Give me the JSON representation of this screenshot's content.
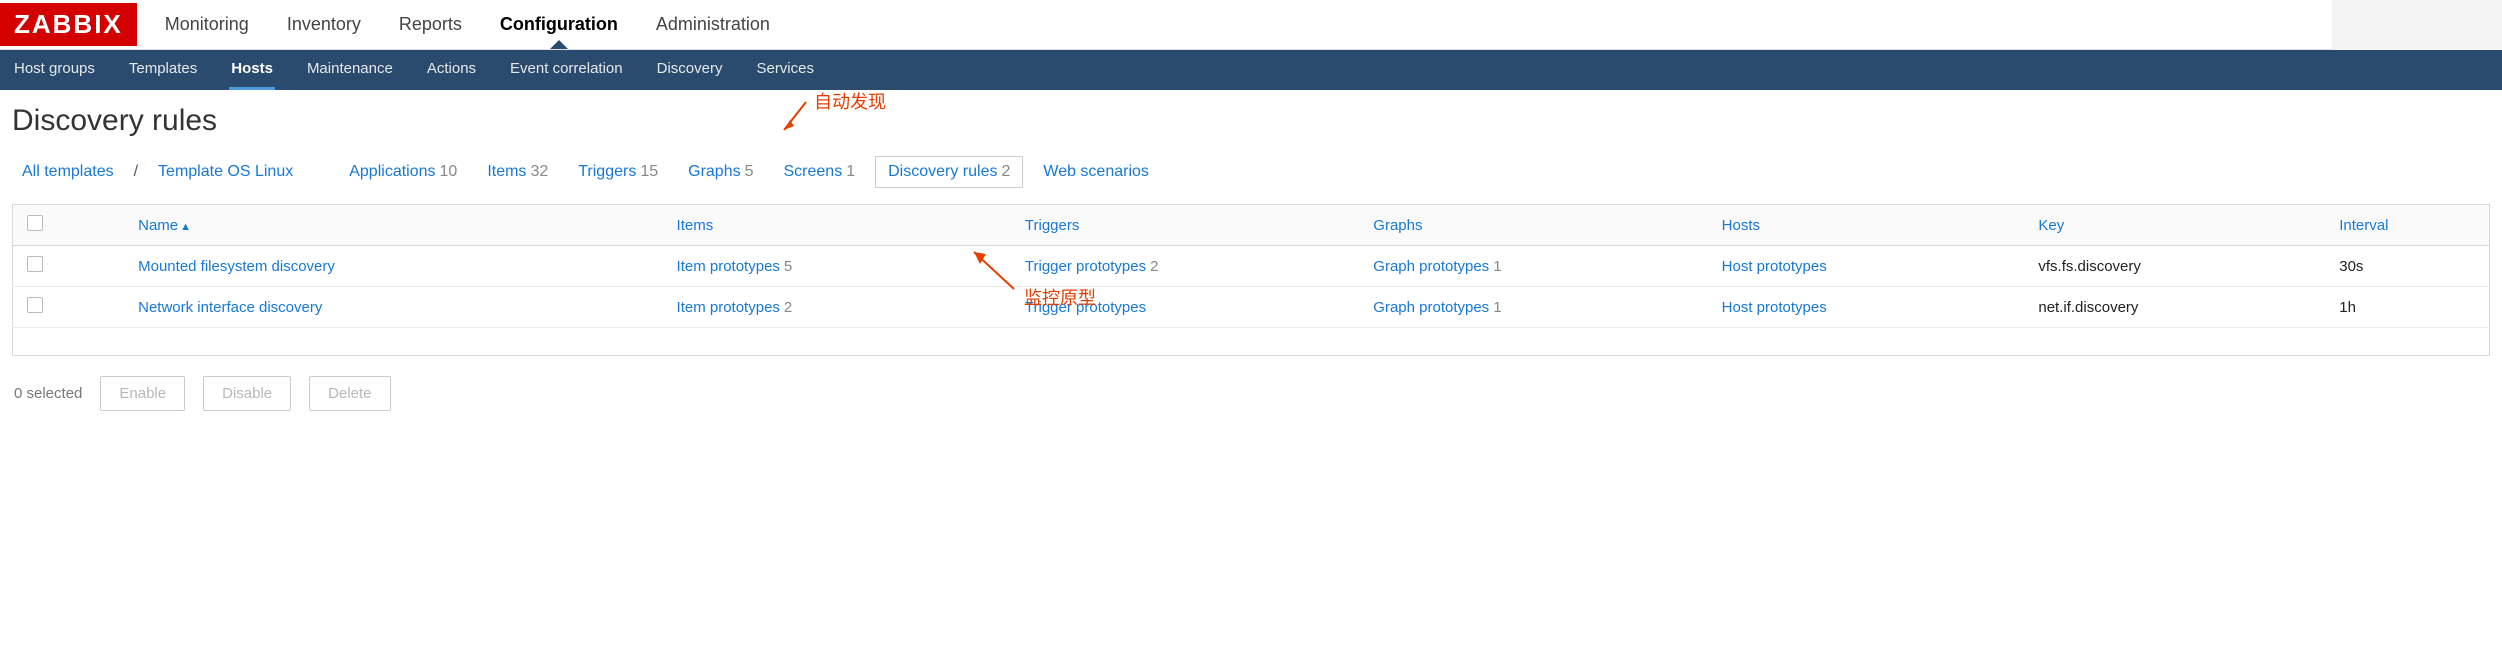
{
  "logo": "ZABBIX",
  "main_nav": {
    "items": [
      "Monitoring",
      "Inventory",
      "Reports",
      "Configuration",
      "Administration"
    ],
    "active_index": 3
  },
  "sub_nav": {
    "items": [
      "Host groups",
      "Templates",
      "Hosts",
      "Maintenance",
      "Actions",
      "Event correlation",
      "Discovery",
      "Services"
    ],
    "active_index": 2
  },
  "page": {
    "title": "Discovery rules"
  },
  "breadcrumb": {
    "all_templates": "All templates",
    "template_name": "Template OS Linux",
    "tabs": [
      {
        "label": "Applications",
        "count": "10"
      },
      {
        "label": "Items",
        "count": "32"
      },
      {
        "label": "Triggers",
        "count": "15"
      },
      {
        "label": "Graphs",
        "count": "5"
      },
      {
        "label": "Screens",
        "count": "1"
      },
      {
        "label": "Discovery rules",
        "count": "2",
        "active": true
      },
      {
        "label": "Web scenarios",
        "count": ""
      }
    ]
  },
  "table": {
    "headers": {
      "name": "Name",
      "sort_indicator": "▲",
      "items": "Items",
      "triggers": "Triggers",
      "graphs": "Graphs",
      "hosts": "Hosts",
      "key": "Key",
      "interval": "Interval"
    },
    "rows": [
      {
        "name": "Mounted filesystem discovery",
        "items_label": "Item prototypes",
        "items_count": "5",
        "triggers_label": "Trigger prototypes",
        "triggers_count": "2",
        "graphs_label": "Graph prototypes",
        "graphs_count": "1",
        "hosts_label": "Host prototypes",
        "key": "vfs.fs.discovery",
        "interval": "30s"
      },
      {
        "name": "Network interface discovery",
        "items_label": "Item prototypes",
        "items_count": "2",
        "triggers_label": "Trigger prototypes",
        "triggers_count": "",
        "graphs_label": "Graph prototypes",
        "graphs_count": "1",
        "hosts_label": "Host prototypes",
        "key": "net.if.discovery",
        "interval": "1h"
      }
    ]
  },
  "footer": {
    "selected_text": "0 selected",
    "enable": "Enable",
    "disable": "Disable",
    "delete": "Delete"
  },
  "annotations": {
    "auto_discover": "自动发现",
    "monitor_prototype": "监控原型"
  }
}
